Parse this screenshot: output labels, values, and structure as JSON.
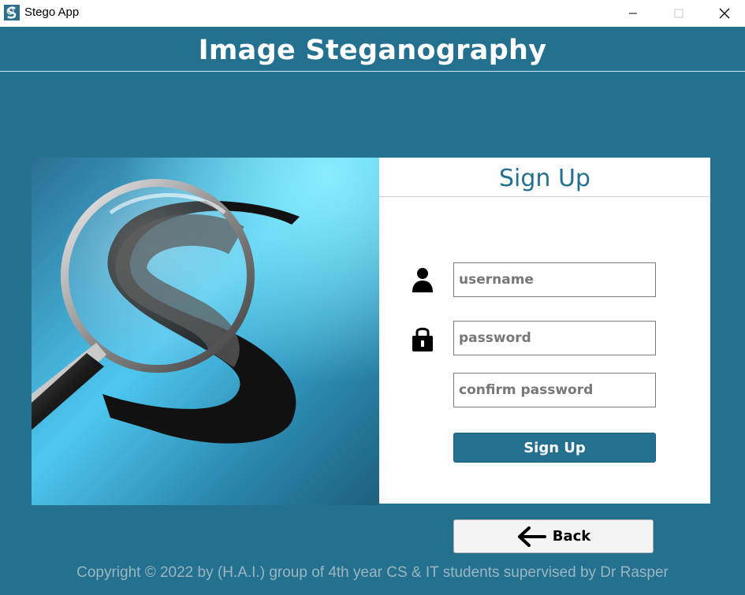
{
  "window": {
    "title": "Stego App",
    "icon": "stego-app-icon",
    "controls": [
      "minimize-icon",
      "maximize-icon",
      "close-icon"
    ]
  },
  "header": {
    "title": "Image Steganography"
  },
  "image_panel": {
    "icon": "magnifier-letter-s-illustration"
  },
  "form": {
    "title": "Sign Up",
    "username_placeholder": "username",
    "password_placeholder": "password",
    "confirm_placeholder": "confirm password",
    "username_icon": "user-icon",
    "password_icon": "lock-icon",
    "submit_label": "Sign Up"
  },
  "back_button": {
    "label": "Back",
    "icon": "arrow-left-icon"
  },
  "footer": {
    "text": "Copyright © 2022 by (H.A.I.) group of 4th year CS & IT students supervised by Dr Rasper"
  },
  "colors": {
    "background": "#24708f",
    "accent": "#24708f",
    "panel": "#ffffff"
  }
}
